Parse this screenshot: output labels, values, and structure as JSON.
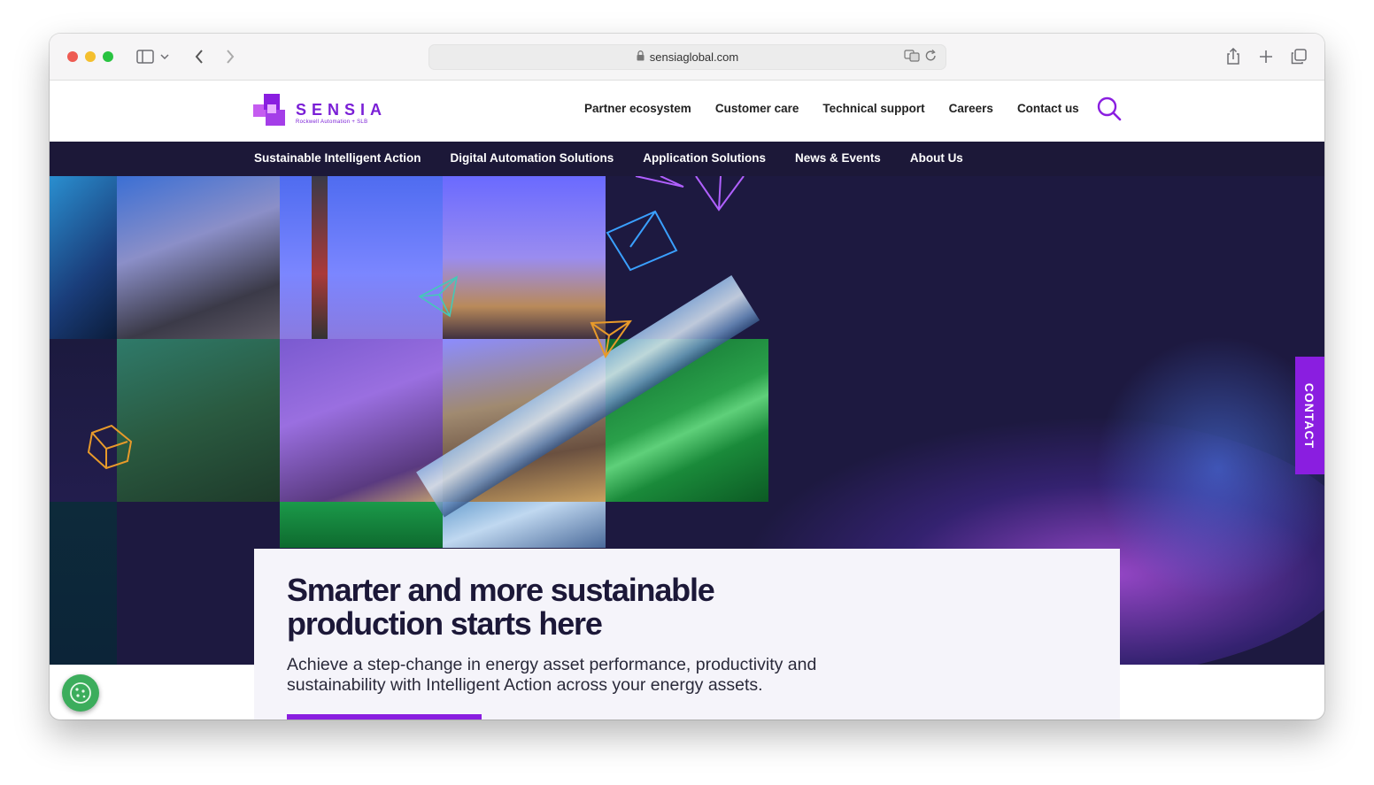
{
  "browser": {
    "url": "sensiaglobal.com",
    "traffic_lights": [
      "#ee5b52",
      "#f4bf2e",
      "#29c341"
    ]
  },
  "header": {
    "logo_word": "SENSIA",
    "logo_sub": "Rockwell Automation + SLB",
    "top_nav": [
      "Partner ecosystem",
      "Customer care",
      "Technical support",
      "Careers",
      "Contact us"
    ]
  },
  "main_nav": [
    "Sustainable Intelligent Action",
    "Digital Automation Solutions",
    "Application Solutions",
    "News & Events",
    "About Us"
  ],
  "hero": {
    "contact_tab": "CONTACT",
    "headline": "Smarter and more sustainable production starts here",
    "body": "Achieve a step-change in energy asset performance, productivity and sustainability with Intelligent Action across your energy assets."
  },
  "colors": {
    "brand_purple": "#8a1ee0",
    "nav_dark": "#1c1838"
  }
}
